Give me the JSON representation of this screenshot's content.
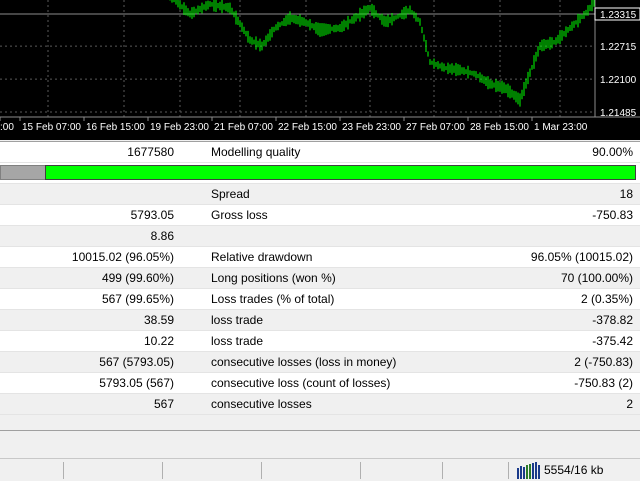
{
  "chart": {
    "price_labels": [
      "1.23315",
      "1.22715",
      "1.22100",
      "1.21485"
    ],
    "price_levels": [
      1.23315,
      1.22715,
      1.221,
      1.21485
    ],
    "current_price": 1.23315,
    "time_labels": [
      ":00",
      "15 Feb 07:00",
      "16 Feb 15:00",
      "19 Feb 23:00",
      "21 Feb 07:00",
      "22 Feb 15:00",
      "23 Feb 23:00",
      "27 Feb 07:00",
      "28 Feb 15:00",
      "1 Mar 23:00"
    ],
    "series_color": "#00ff00",
    "background": "#000000"
  },
  "report": {
    "rows": [
      {
        "v1": "1677580",
        "l2": "Modelling quality",
        "v2": "90.00%"
      },
      {
        "type": "bar",
        "quality_fraction": 0.93
      },
      {
        "v1": "",
        "l2": "Spread",
        "v2": "18"
      },
      {
        "v1": "5793.05",
        "l2": "Gross loss",
        "v2": "-750.83"
      },
      {
        "v1": "8.86",
        "l2": "",
        "v2": ""
      },
      {
        "v1": "10015.02 (96.05%)",
        "l2": "Relative drawdown",
        "v2": "96.05% (10015.02)"
      },
      {
        "v1": "499 (99.60%)",
        "l2": "Long positions (won %)",
        "v2": "70 (100.00%)"
      },
      {
        "v1": "567 (99.65%)",
        "l2": "Loss trades (% of total)",
        "v2": "2 (0.35%)"
      },
      {
        "v1": "38.59",
        "l2": "loss trade",
        "v2": "-378.82"
      },
      {
        "v1": "10.22",
        "l2": "loss trade",
        "v2": "-375.42"
      },
      {
        "v1": "567 (5793.05)",
        "l2": "consecutive losses (loss in money)",
        "v2": "2 (-750.83)"
      },
      {
        "v1": "5793.05 (567)",
        "l2": "consecutive loss (count of losses)",
        "v2": "-750.83 (2)"
      },
      {
        "v1": "567",
        "l2": "consecutive losses",
        "v2": "2"
      }
    ]
  },
  "statusbar": {
    "traffic": "5554/16 kb"
  }
}
